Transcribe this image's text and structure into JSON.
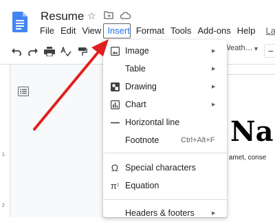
{
  "header": {
    "title": "Resume",
    "menu": [
      "File",
      "Edit",
      "View",
      "Insert",
      "Format",
      "Tools",
      "Add-ons",
      "Help"
    ],
    "last_edit": "Las"
  },
  "toolbar": {
    "font_name": "Weath…",
    "icons": [
      "undo-icon",
      "redo-icon",
      "print-icon",
      "spellcheck-icon",
      "paint-format-icon"
    ]
  },
  "ruler": {
    "numbers": [
      "1",
      "2"
    ]
  },
  "document": {
    "heading": "r Na",
    "body_text": "sit amet, conse"
  },
  "insert_menu": {
    "items": [
      {
        "label": "Image",
        "icon": "image-icon",
        "submenu": true
      },
      {
        "label": "Table",
        "icon": "",
        "submenu": true
      },
      {
        "label": "Drawing",
        "icon": "drawing-icon",
        "submenu": true
      },
      {
        "label": "Chart",
        "icon": "chart-icon",
        "submenu": true
      },
      {
        "label": "Horizontal line",
        "icon": "horizontal-line-icon",
        "submenu": false
      },
      {
        "label": "Footnote",
        "icon": "",
        "shortcut": "Ctrl+Alt+F",
        "submenu": false
      },
      {
        "label": "Special characters",
        "icon": "omega-icon",
        "submenu": false
      },
      {
        "label": "Equation",
        "icon": "pi-icon",
        "submenu": false
      },
      {
        "label": "Headers & footers",
        "icon": "",
        "submenu": true
      }
    ]
  },
  "colors": {
    "arrow": "#e0201e",
    "docs_blue": "#4285f4",
    "active_menu": "#1a73e8"
  }
}
